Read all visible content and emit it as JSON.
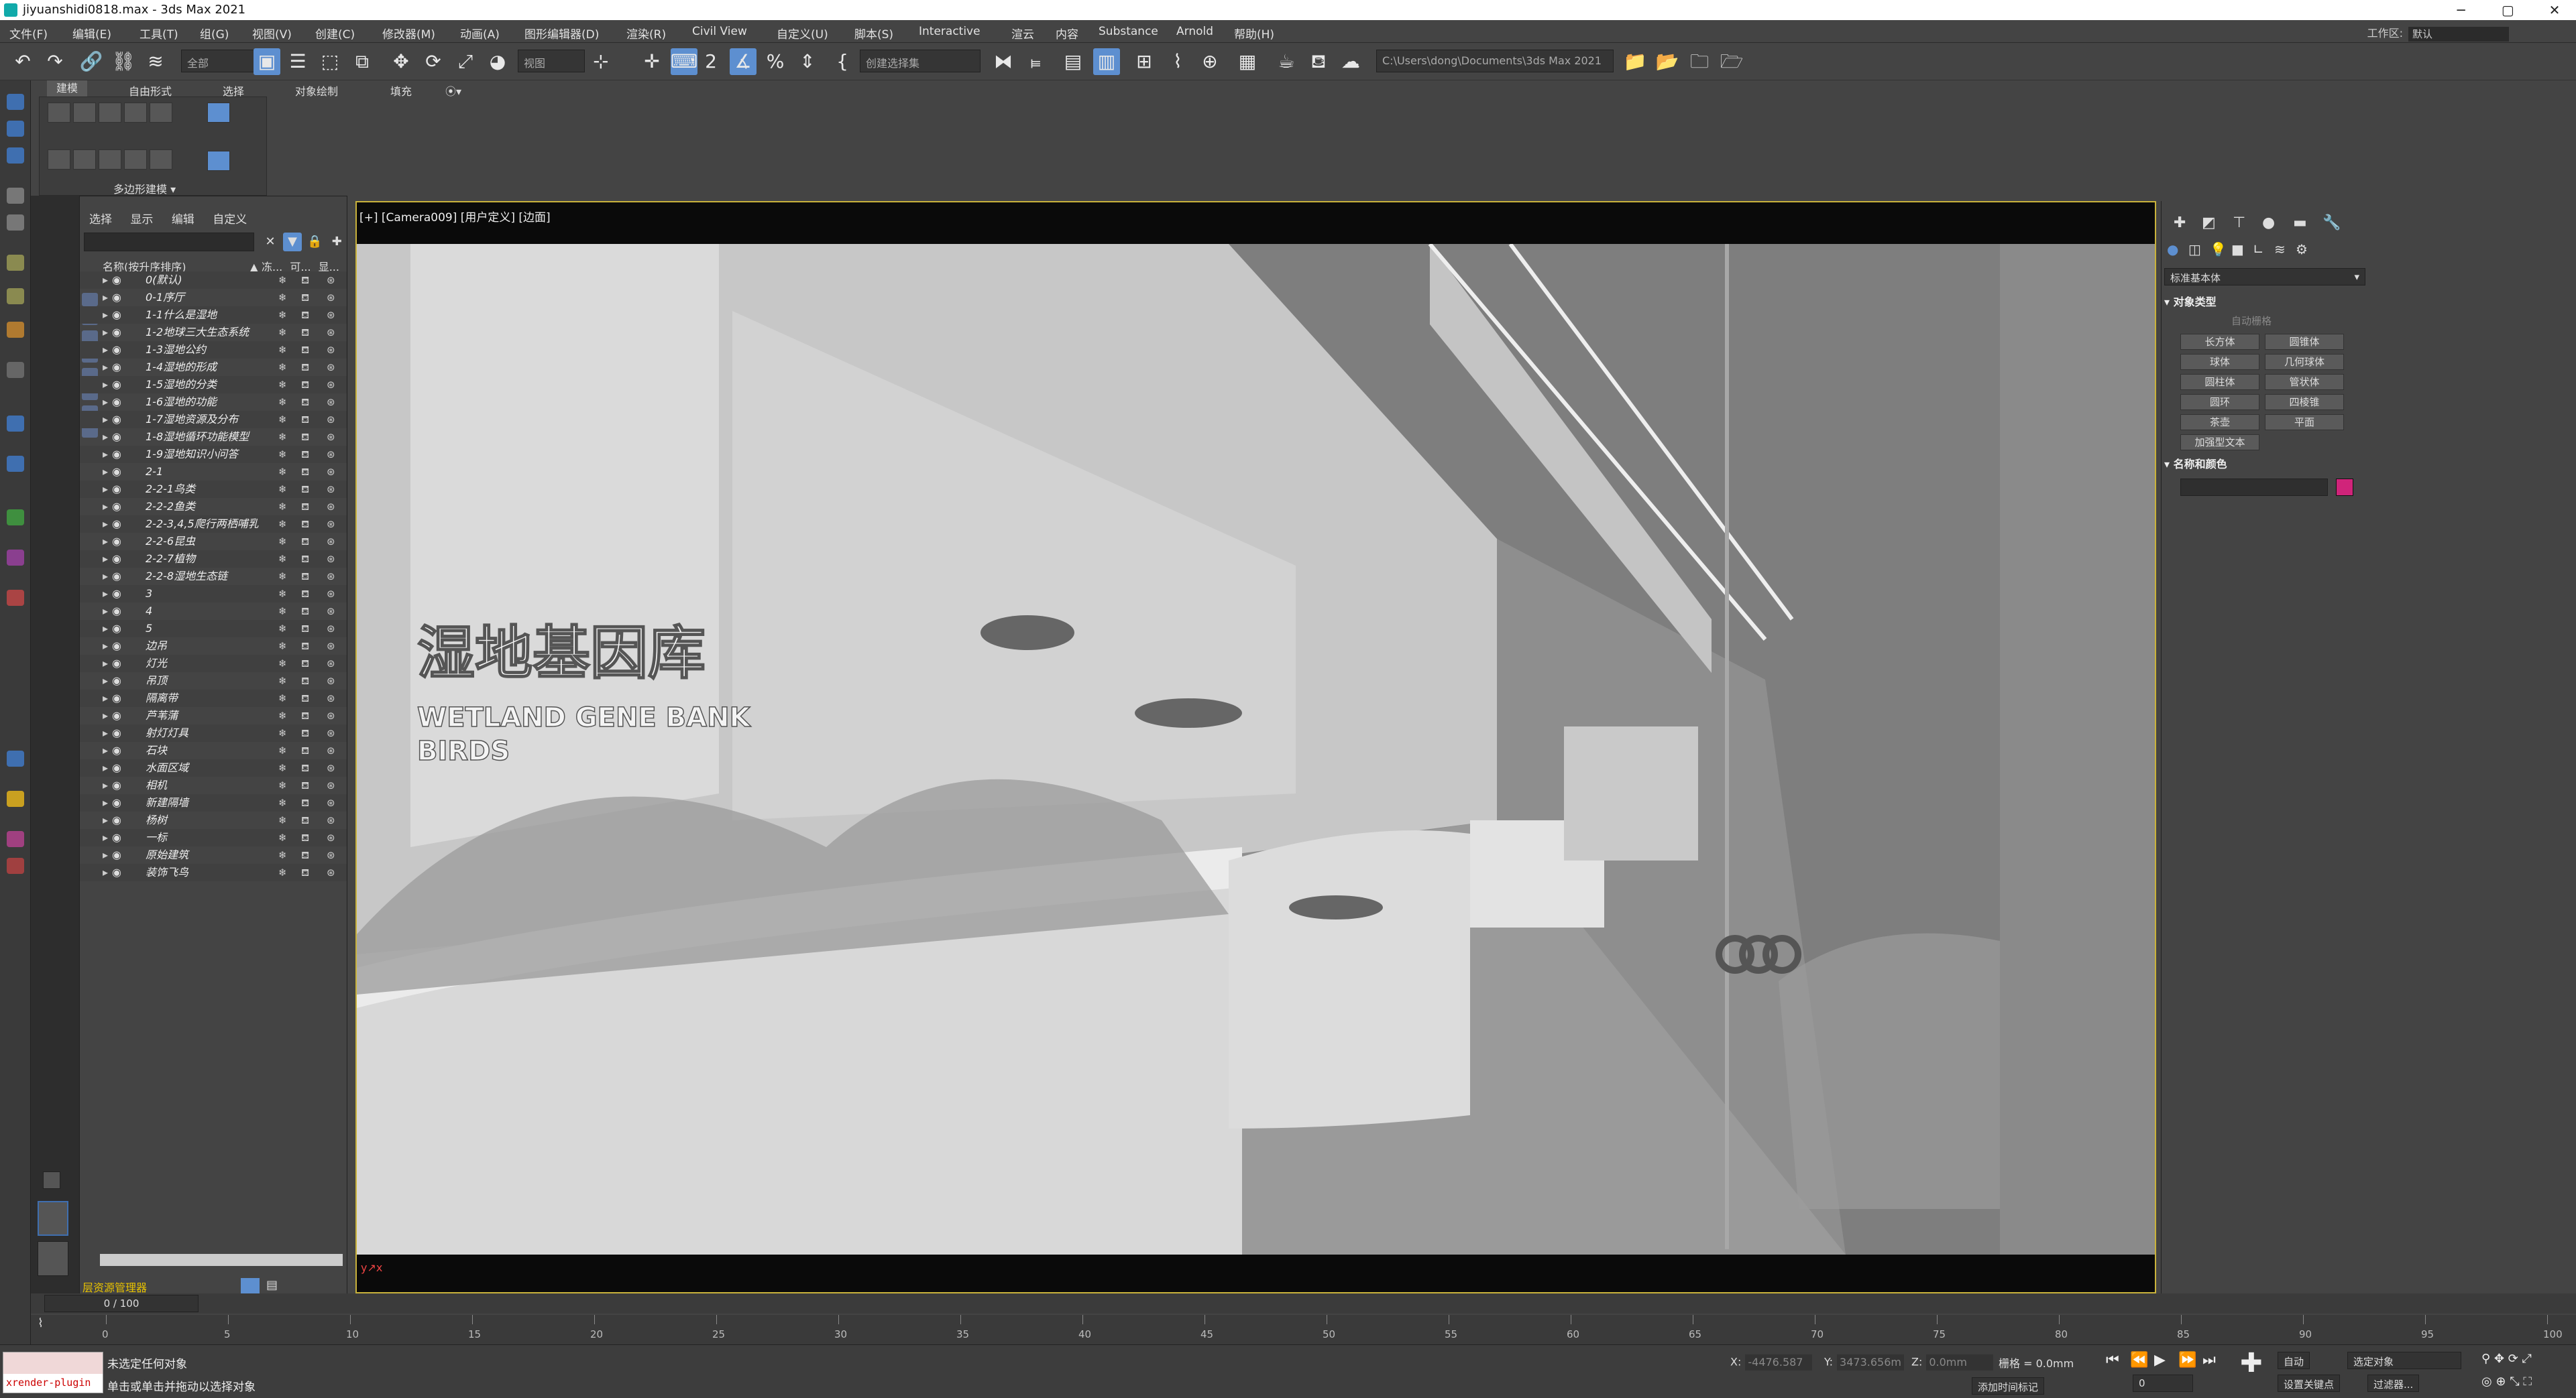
{
  "window": {
    "title": "jiyuanshidi0818.max - 3ds Max 2021",
    "min": "─",
    "max": "▢",
    "close": "✕"
  },
  "menu": [
    "文件(F)",
    "编辑(E)",
    "工具(T)",
    "组(G)",
    "视图(V)",
    "创建(C)",
    "修改器(M)",
    "动画(A)",
    "图形编辑器(D)",
    "渲染(R)",
    "Civil View",
    "自定义(U)",
    "脚本(S)",
    "Interactive",
    "渲云",
    "内容",
    "Substance",
    "Arnold",
    "帮助(H)"
  ],
  "workspace": {
    "label": "工作区:",
    "value": "默认"
  },
  "toolbar": {
    "filter_all": "全部",
    "view_dd": "视图",
    "selection_set": "创建选择集",
    "path": "C:\\Users\\dong\\Documents\\3ds Max 2021"
  },
  "ribbon": {
    "tabs": [
      "建模",
      "自由形式",
      "选择",
      "对象绘制",
      "填充"
    ],
    "panel_label": "多边形建模 ▾"
  },
  "scene_explorer": {
    "tabs": [
      "选择",
      "显示",
      "编辑",
      "自定义"
    ],
    "header": "名称(按升序排序)",
    "col_headers": [
      "▲ 冻...",
      "可...",
      "显..."
    ],
    "footer": "层资源管理器",
    "rows": [
      "0(默认)",
      "0-1序厅",
      "1-1什么是湿地",
      "1-2地球三大生态系统",
      "1-3湿地公约",
      "1-4湿地的形成",
      "1-5湿地的分类",
      "1-6湿地的功能",
      "1-7湿地资源及分布",
      "1-8湿地循环功能模型",
      "1-9湿地知识小问答",
      "2-1",
      "2-2-1鸟类",
      "2-2-2鱼类",
      "2-2-3,4,5爬行两栖哺乳",
      "2-2-6昆虫",
      "2-2-7植物",
      "2-2-8湿地生态链",
      "3",
      "4",
      "5",
      "边吊",
      "灯光",
      "吊顶",
      "隔离带",
      "芦苇蒲",
      "射灯灯具",
      "石块",
      "水面区域",
      "相机",
      "新建隔墙",
      "杨树",
      "一标",
      "原始建筑",
      "装饰飞鸟"
    ]
  },
  "viewport": {
    "label": "[+] [Camera009] [用户定义] [边面]",
    "sign_zh": "湿地基因库",
    "sign_en1": "WETLAND GENE BANK",
    "sign_en2": "BIRDS"
  },
  "command_panel": {
    "dropdown": "标准基本体",
    "rollout_object_type": "▾ 对象类型",
    "autogrid": "自动栅格",
    "objects": [
      "长方体",
      "圆锥体",
      "球体",
      "几何球体",
      "圆柱体",
      "管状体",
      "圆环",
      "四棱锥",
      "茶壶",
      "平面",
      "加强型文本"
    ],
    "rollout_name_color": "▾ 名称和颜色",
    "color": "#d0247a"
  },
  "timeline": {
    "slider": "0 / 100",
    "ticks": [
      "0",
      "5",
      "10",
      "15",
      "20",
      "25",
      "30",
      "35",
      "40",
      "45",
      "50",
      "55",
      "60",
      "65",
      "70",
      "75",
      "80",
      "85",
      "90",
      "95",
      "100"
    ]
  },
  "status": {
    "maxscript": "xrender-plugin",
    "line1": "未选定任何对象",
    "line2": "单击或单击并拖动以选择对象",
    "x_label": "X:",
    "x_val": "-4476.587",
    "y_label": "Y:",
    "y_val": "3473.656m",
    "z_label": "Z:",
    "z_val": "0.0mm",
    "grid": "栅格 = 0.0mm",
    "add_tag": "添加时间标记",
    "auto": "自动",
    "set_key": "设置关键点",
    "selected": "选定对象",
    "filters": "过滤器...",
    "frame": "0"
  }
}
